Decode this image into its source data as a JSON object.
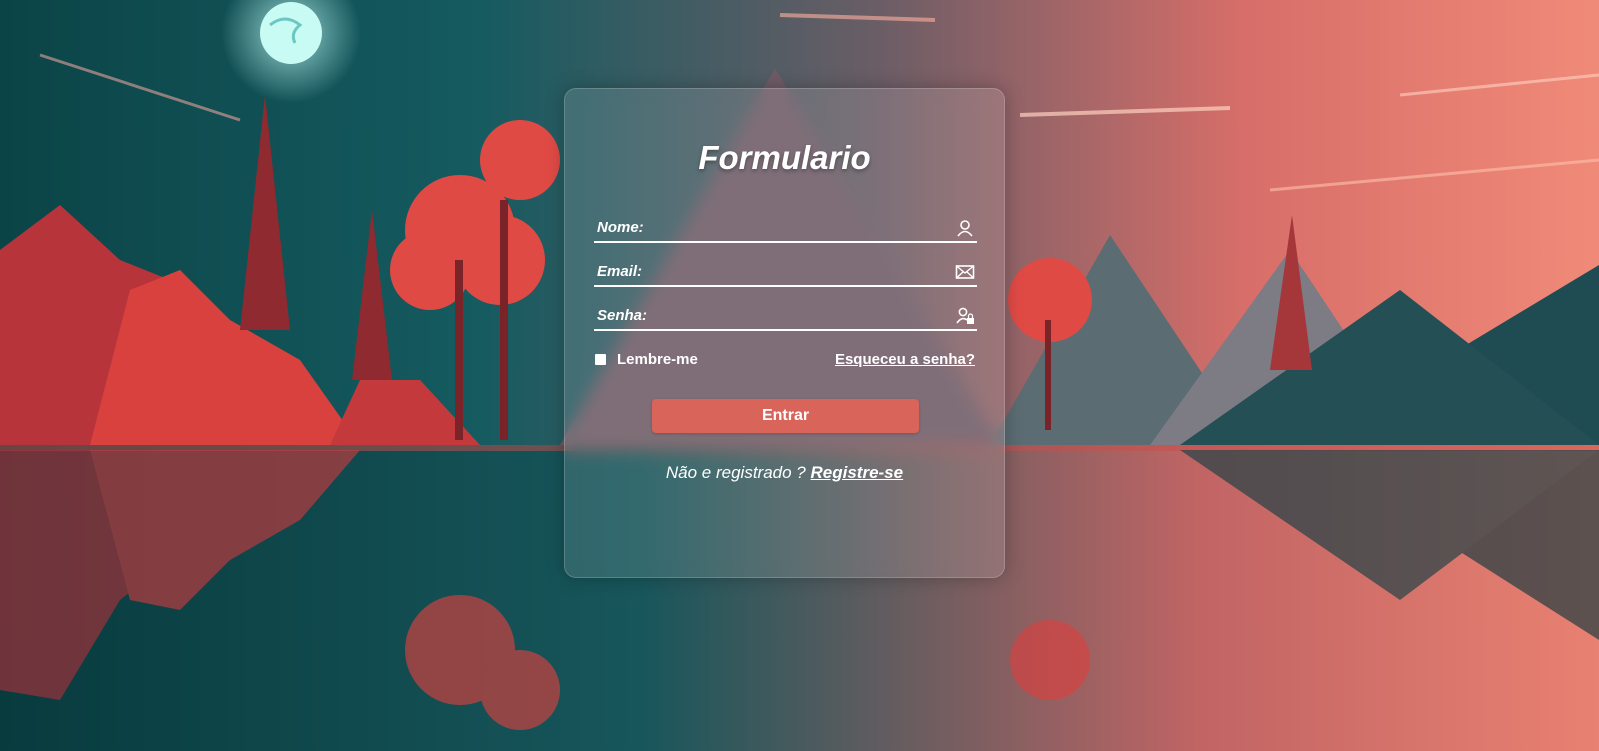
{
  "form": {
    "title": "Formulario",
    "fields": [
      {
        "label": "Nome:",
        "icon": "user-icon"
      },
      {
        "label": "Email:",
        "icon": "envelope-icon"
      },
      {
        "label": "Senha:",
        "icon": "user-lock-icon"
      }
    ],
    "remember_label": "Lembre-me",
    "remember_checked": false,
    "forgot_label": "Esqueceu a senha?",
    "submit_label": "Entrar",
    "register_prompt": "Não e registrado ?",
    "register_link": "Registre-se"
  },
  "colors": {
    "accent": "#d9655a",
    "text": "#ffffff"
  }
}
